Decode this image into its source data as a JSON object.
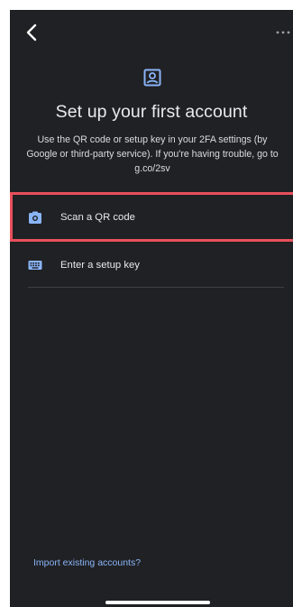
{
  "header": {
    "back_icon": "chevron-left-icon",
    "more_icon": "more-horizontal-icon"
  },
  "hero": {
    "icon": "account-box-icon",
    "title": "Set up your first account",
    "subtitle": "Use the QR code or setup key in your 2FA settings (by Google or third-party service). If you're having trouble, go to g.co/2sv"
  },
  "options": [
    {
      "icon": "camera-icon",
      "label": "Scan a QR code"
    },
    {
      "icon": "keyboard-icon",
      "label": "Enter a setup key"
    }
  ],
  "footer": {
    "import_label": "Import existing accounts?"
  },
  "colors": {
    "background": "#202124",
    "text_primary": "#e8eaed",
    "icon_accent": "#8ab4f8",
    "link": "#8ab4f8",
    "highlight": "#e8505b"
  }
}
